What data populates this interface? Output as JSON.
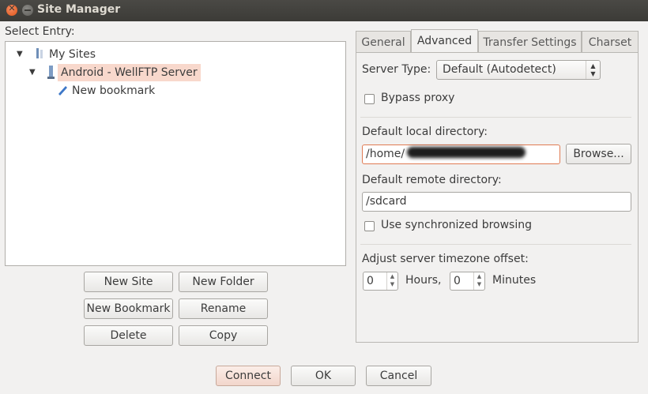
{
  "window": {
    "title": "Site Manager"
  },
  "left": {
    "select_entry_label": "Select Entry:",
    "tree": {
      "root": "My Sites",
      "server": "Android - WellFTP Server",
      "bookmark": "New bookmark"
    },
    "buttons": {
      "new_site": "New Site",
      "new_folder": "New Folder",
      "new_bookmark": "New Bookmark",
      "rename": "Rename",
      "delete": "Delete",
      "copy": "Copy"
    }
  },
  "tabs": [
    "General",
    "Advanced",
    "Transfer Settings",
    "Charset"
  ],
  "active_tab": "Advanced",
  "advanced": {
    "server_type_label": "Server Type:",
    "server_type_value": "Default (Autodetect)",
    "bypass_proxy_label": "Bypass proxy",
    "bypass_proxy_checked": false,
    "local_dir_label": "Default local directory:",
    "local_dir_value": "/home/",
    "browse_label": "Browse...",
    "remote_dir_label": "Default remote directory:",
    "remote_dir_value": "/sdcard",
    "sync_browsing_label": "Use synchronized browsing",
    "sync_browsing_checked": false,
    "tz_label": "Adjust server timezone offset:",
    "hours_value": "0",
    "hours_label": "Hours,",
    "minutes_value": "0",
    "minutes_label": "Minutes"
  },
  "footer": {
    "connect": "Connect",
    "ok": "OK",
    "cancel": "Cancel"
  },
  "colors": {
    "titlebar": "#3c3b37",
    "selection": "#f8d8cc",
    "focus_border": "#e07b53",
    "close_button": "#e05519"
  }
}
